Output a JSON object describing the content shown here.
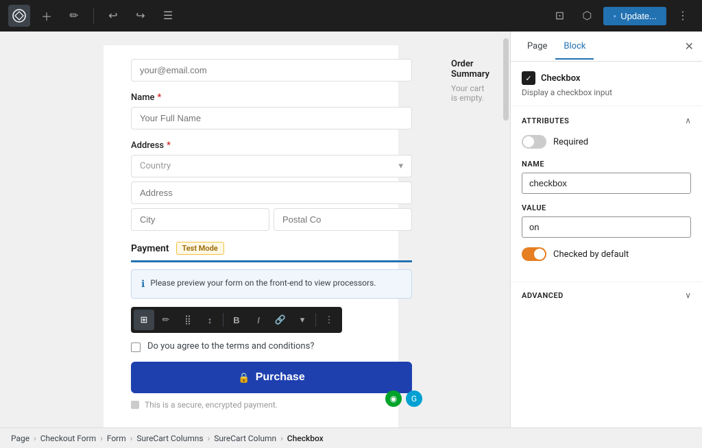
{
  "toolbar": {
    "wp_logo": "W",
    "update_label": "Update...",
    "icons": [
      "add",
      "edit",
      "undo",
      "redo",
      "menu"
    ]
  },
  "breadcrumb": {
    "items": [
      "Page",
      "Checkout Form",
      "Form",
      "SureCart Columns",
      "SureCart Column",
      "Checkbox"
    ]
  },
  "right_panel": {
    "tabs": [
      "Page",
      "Block"
    ],
    "active_tab": "Block",
    "block": {
      "title": "Checkbox",
      "description": "Display a checkbox input",
      "icon": "✓"
    },
    "attributes_section": "Attributes",
    "required_label": "Required",
    "required_on": false,
    "name_label": "NAME",
    "name_value": "checkbox",
    "value_label": "VALUE",
    "value_value": "on",
    "checked_label": "Checked by default",
    "checked_on": true,
    "advanced_label": "Advanced"
  },
  "canvas": {
    "email_placeholder": "your@email.com",
    "name_label": "Name",
    "name_placeholder": "Your Full Name",
    "address_label": "Address",
    "country_placeholder": "Country",
    "address_placeholder": "Address",
    "city_placeholder": "City",
    "postal_placeholder": "Postal Co",
    "payment_label": "Payment",
    "test_mode_badge": "Test Mode",
    "payment_info": "Please preview your form on the front-end to view processors.",
    "checkbox_text": "Do you agree to the terms and conditions?",
    "purchase_label": "Purchase",
    "secure_text": "This is a secure, encrypted payment.",
    "order_summary_title": "Order Summary",
    "order_summary_empty": "Your cart is empty."
  },
  "floating_toolbar": {
    "buttons": [
      "☰",
      "✏",
      "⣿",
      "↕",
      "B",
      "I",
      "🔗",
      "▾",
      "⋮"
    ]
  }
}
